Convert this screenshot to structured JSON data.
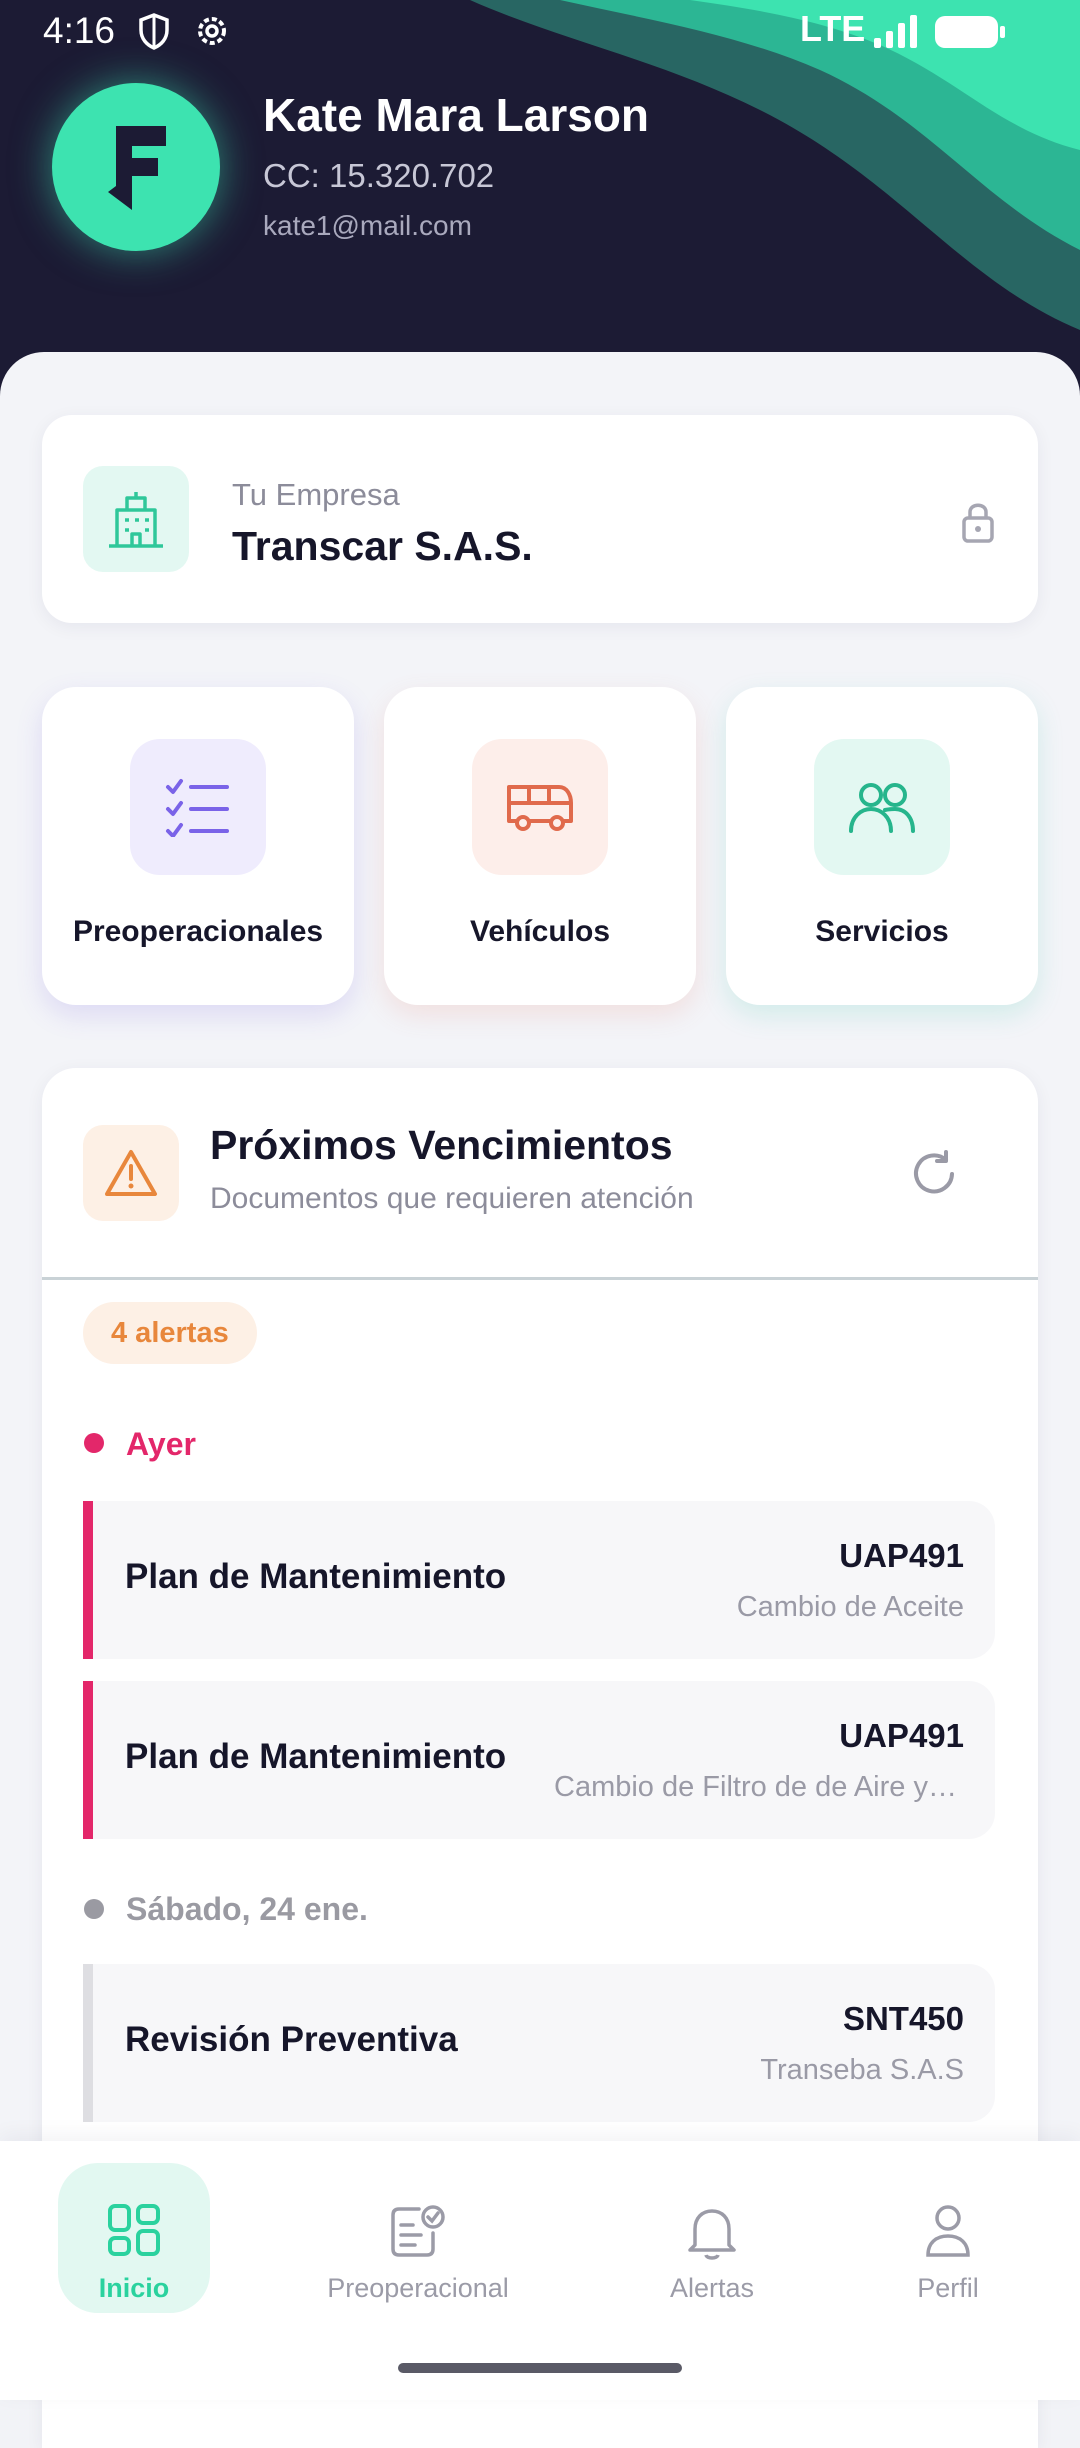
{
  "status_bar": {
    "time": "4:16",
    "network": "LTE"
  },
  "profile": {
    "initial": "F",
    "name": "Kate Mara Larson",
    "id_line": "CC: 15.320.702",
    "email": "kate1@mail.com"
  },
  "company": {
    "label": "Tu Empresa",
    "name": "Transcar S.A.S."
  },
  "tiles": [
    {
      "label": "Preoperacionales",
      "icon": "checklist-icon",
      "color": "#7a63e8",
      "bg": "#efecfd"
    },
    {
      "label": "Vehículos",
      "icon": "bus-icon",
      "color": "#e06a4c",
      "bg": "#fdeeea"
    },
    {
      "label": "Servicios",
      "icon": "users-icon",
      "color": "#26b58c",
      "bg": "#e3f8f2"
    }
  ],
  "alerts": {
    "title": "Próximos Vencimientos",
    "subtitle": "Documentos que requieren atención",
    "badge": "4 alertas",
    "groups": [
      {
        "label": "Ayer",
        "color": "#e3276a",
        "items": [
          {
            "title": "Plan de Mantenimiento",
            "plate": "UAP491",
            "desc": "Cambio de Aceite"
          },
          {
            "title": "Plan de Mantenimiento",
            "plate": "UAP491",
            "desc": "Cambio de Filtro de de Aire y Filtros"
          }
        ]
      },
      {
        "label": "Sábado, 24 ene.",
        "color": "#9a9aa2",
        "items": [
          {
            "title": "Revisión Preventiva",
            "plate": "SNT450",
            "desc": "Transeba S.A.S"
          }
        ]
      }
    ]
  },
  "nav": {
    "active": "Inicio",
    "items": [
      {
        "label": "Inicio",
        "icon": "grid-icon"
      },
      {
        "label": "Preoperacional",
        "icon": "checked-document-icon"
      },
      {
        "label": "Alertas",
        "icon": "bell-icon"
      },
      {
        "label": "Perfil",
        "icon": "user-icon"
      }
    ]
  },
  "colors": {
    "accent": "#3de3b0",
    "header_bg": "#1c1b34",
    "danger": "#e3276a",
    "warning": "#e8873c"
  }
}
